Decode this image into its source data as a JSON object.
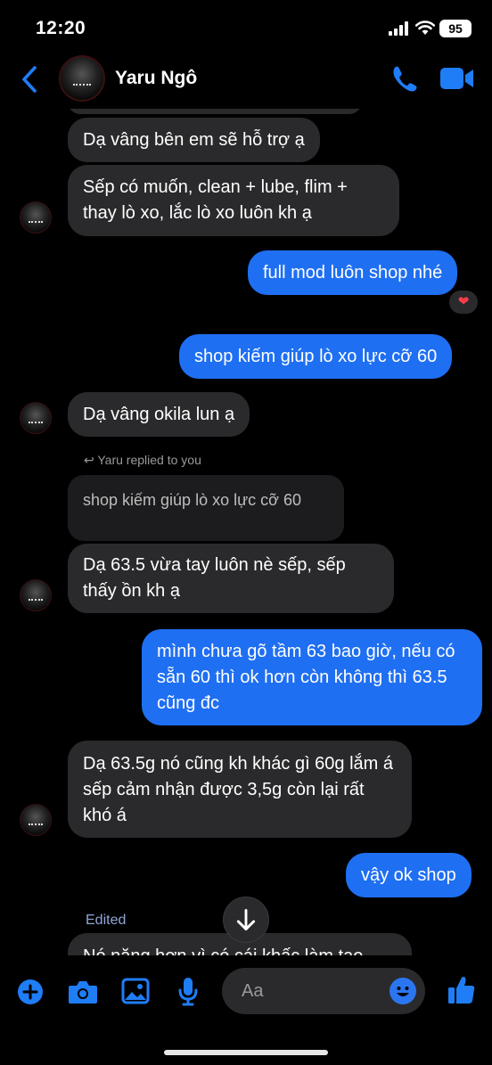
{
  "status_bar": {
    "time": "12:20",
    "battery": "95"
  },
  "header": {
    "contact_name": "Yaru Ngô"
  },
  "messages": [
    {
      "text": "Dạ vâng bên em sẽ hỗ trợ ạ"
    },
    {
      "text": "Sếp có muốn, clean + lube, flim + thay lò xo, lắc lò xo luôn kh ạ"
    },
    {
      "text": "full mod luôn shop nhé",
      "reaction": "❤"
    },
    {
      "text": "shop kiếm giúp lò xo lực cỡ 60"
    },
    {
      "text": "Dạ vâng okila lun ạ"
    },
    {
      "reply_note": "Yaru replied to you",
      "quoted": "shop kiếm giúp lò xo lực cỡ 60",
      "text": "Dạ 63.5 vừa tay luôn nè sếp, sếp thấy ồn kh ạ"
    },
    {
      "text": "mình chưa gõ tầm 63 bao giờ, nếu có sẵn 60 thì ok hơn còn không thì 63.5 cũng đc"
    },
    {
      "text": "Dạ 63.5g nó cũng kh khác gì 60g lắm á sếp cảm nhận được 3,5g còn lại rất khó á"
    },
    {
      "text": "vậy ok shop"
    },
    {
      "edited": "Edited",
      "text": "Nó nặng hơn vì có cái khấc làm tao"
    }
  ],
  "composer": {
    "placeholder": "Aa"
  },
  "colors": {
    "accent": "#1f6ff2",
    "incoming": "#2a2a2c",
    "background": "#000000"
  }
}
